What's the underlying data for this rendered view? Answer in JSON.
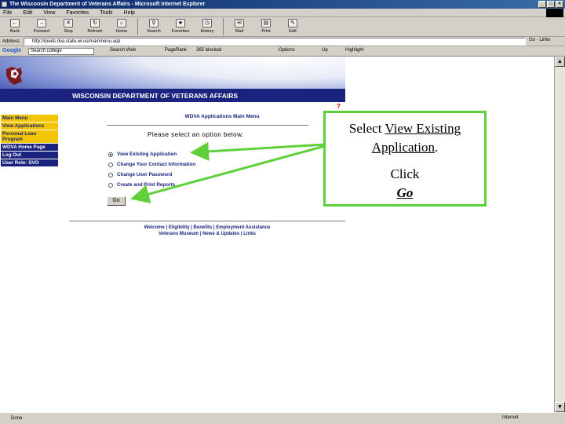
{
  "window": {
    "title": "The Wisconsin Department of Veterans Affairs - Microsoft Internet Explorer"
  },
  "menu": [
    "File",
    "Edit",
    "View",
    "Favorites",
    "Tools",
    "Help"
  ],
  "toolbar": [
    "Back",
    "Forward",
    "Stop",
    "Refresh",
    "Home",
    "Search",
    "Favorites",
    "History",
    "Mail",
    "Print",
    "Edit"
  ],
  "address": {
    "label": "Address",
    "url": "http://rpeds.dva.state.wi.us/mainmenu.asp",
    "go": "Go",
    "links": "Links"
  },
  "google": {
    "logo": "Google",
    "query": "Search college",
    "items": [
      "Search Web",
      "PageRank",
      "365 blocked",
      "Options",
      "Up",
      "Highlight"
    ]
  },
  "site": {
    "title": "WISCONSIN DEPARTMENT OF VETERANS AFFAIRS",
    "help": "?"
  },
  "sidenav": [
    {
      "label": "Main Menu",
      "style": "y"
    },
    {
      "label": "View Applications",
      "style": "y"
    },
    {
      "label": "Personal Loan Program",
      "style": "y"
    },
    {
      "label": "WDVA Home Page",
      "style": "b"
    },
    {
      "label": "Log Out",
      "style": "b"
    },
    {
      "label": "User Role: SVO",
      "style": "b"
    }
  ],
  "main": {
    "heading": "WDVA Applications Main Menu",
    "instruction": "Please select an option below.",
    "options": [
      "View Existing Application",
      "Change Your Contact Information",
      "Change User Password",
      "Create and Print Reports"
    ],
    "selected_index": 0,
    "go_label": "Go"
  },
  "footer": {
    "row1": [
      "Welcome",
      "Eligibility",
      "Benefits",
      "Employment Assistance"
    ],
    "row2": [
      "Veterans Museum",
      "News & Updates",
      "Links"
    ]
  },
  "callout": {
    "select": "Select",
    "view_existing": "View Existing",
    "application": "Application",
    "period": ".",
    "click": "Click",
    "go": "Go"
  },
  "status": {
    "text": "Done",
    "zone": "Internet"
  },
  "colors": {
    "navy": "#1a237e",
    "gold": "#f2c500",
    "callout_green": "#5ed13a"
  }
}
